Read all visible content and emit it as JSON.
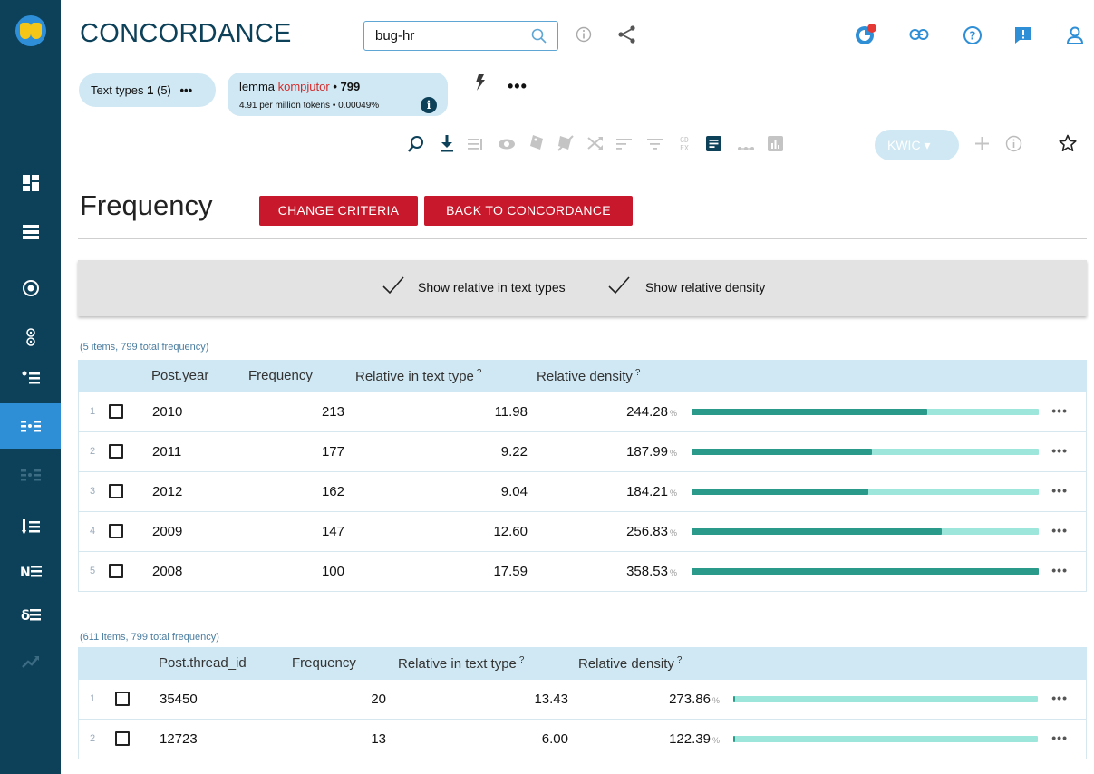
{
  "app": {
    "title": "CONCORDANCE",
    "corpus": "bug-hr"
  },
  "chips": {
    "text_types": {
      "prefix": "Text types ",
      "count": "1",
      "suffix": " (5)",
      "more": "•••"
    },
    "lemma": {
      "label": "lemma ",
      "word": "kompjutor",
      "count": " • 799",
      "stats": "4.91 per million tokens • 0.00049%",
      "info": "i"
    }
  },
  "top_more": "•••",
  "toolbar": {
    "view_select": "KWIC ▾"
  },
  "page": {
    "title": "Frequency",
    "change_criteria": "CHANGE CRITERIA",
    "back": "BACK TO CONCORDANCE"
  },
  "options": {
    "show_relative_text_types": "Show relative in text types",
    "show_relative_density": "Show relative density"
  },
  "tables": [
    {
      "caption": "(5 items, 799 total frequency)",
      "columns": [
        "Post.year",
        "Frequency",
        "Relative in text type",
        "Relative density"
      ],
      "help_mark": "?",
      "pct_unit": "%",
      "rows": [
        {
          "n": "1",
          "value": "2010",
          "freq": "213",
          "rel": "11.98",
          "density": "244.28",
          "bar_fill": 0.68
        },
        {
          "n": "2",
          "value": "2011",
          "freq": "177",
          "rel": "9.22",
          "density": "187.99",
          "bar_fill": 0.52
        },
        {
          "n": "3",
          "value": "2012",
          "freq": "162",
          "rel": "9.04",
          "density": "184.21",
          "bar_fill": 0.51
        },
        {
          "n": "4",
          "value": "2009",
          "freq": "147",
          "rel": "12.60",
          "density": "256.83",
          "bar_fill": 0.72
        },
        {
          "n": "5",
          "value": "2008",
          "freq": "100",
          "rel": "17.59",
          "density": "358.53",
          "bar_fill": 1.0
        }
      ]
    },
    {
      "caption": "(611 items, 799 total frequency)",
      "columns": [
        "Post.thread_id",
        "Frequency",
        "Relative in text type",
        "Relative density"
      ],
      "help_mark": "?",
      "pct_unit": "%",
      "rows": [
        {
          "n": "1",
          "value": "35450",
          "freq": "20",
          "rel": "13.43",
          "density": "273.86",
          "bar_fill": 0.005
        },
        {
          "n": "2",
          "value": "12723",
          "freq": "13",
          "rel": "6.00",
          "density": "122.39",
          "bar_fill": 0.003
        }
      ]
    }
  ],
  "row_more": "•••",
  "colors": {
    "sidebar": "#0d4159",
    "accent_red": "#c7192b",
    "header_blue": "#cfe8f3",
    "bar_dark": "#2a9a8b",
    "bar_light": "#9de6dc"
  }
}
